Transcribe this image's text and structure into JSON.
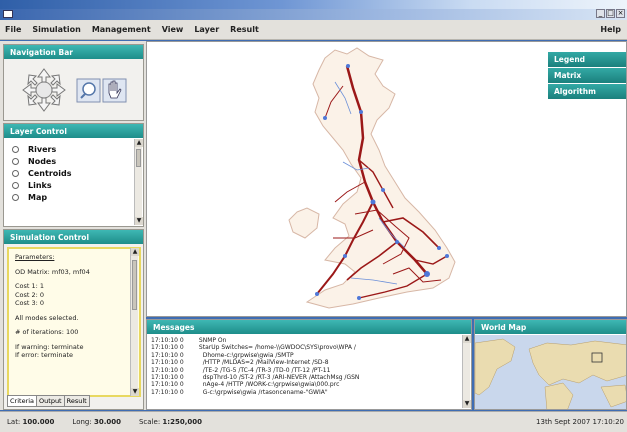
{
  "menu": {
    "items": [
      "File",
      "Simulation",
      "Management",
      "View",
      "Layer",
      "Result"
    ],
    "help": "Help"
  },
  "nav": {
    "title": "Navigation Bar"
  },
  "layer_control": {
    "title": "Layer Control",
    "layers": [
      "Rivers",
      "Nodes",
      "Centroids",
      "Links",
      "Map"
    ]
  },
  "simulation": {
    "title": "Simulation Control",
    "params_label": "Parameters:",
    "od_matrix": "OD Matrix: mf03, mf04",
    "cost1": "Cost 1:  1",
    "cost2": "Cost 2:  0",
    "cost3": "Cost 3:  0",
    "modes": "All modes selected.",
    "iterations": "# of iterations: 100",
    "if_warning": "If warning:  terminate",
    "if_error": "If error:  terminate",
    "tabs": [
      "Criteria",
      "Output",
      "Result"
    ]
  },
  "legend_panel": {
    "items": [
      "Legend",
      "Matrix",
      "Algorithm"
    ]
  },
  "messages": {
    "title": "Messages",
    "log": "17:10:10 0        SNMP On\n17:10:10 0        StarUp Switches= /home-\\\\GWDOC\\SYS\\provo\\WPA /\n17:10:10 0          Dhome-c:\\grpwise\\gwia /SMTP\n17:10:10 0          /HTTP /MLDAS=2 /MailView-Internet /SD-8\n17:10:10 0          /TE-2 /TG-5 /TC-4 /TR-3 /TD-0 /TT-12 /PT-11\n17:10:10 0          dspThrd-10 /ST-2 /RT-3 /ARI-NEVER /AttachMsg /GSN\n17:10:10 0          nAge-4 /HTTP /WORK-c:\\grpwise\\gwia\\000.prc\n17:10:10 0          G-c:\\grpwise\\gwia /rtasoncename-\"GWIA\""
  },
  "world_map": {
    "title": "World Map"
  },
  "status": {
    "lat_label": "Lat:",
    "lat": "100.000",
    "long_label": "Long:",
    "long": "30.000",
    "scale_label": "Scale:",
    "scale": "1:250,000",
    "datetime": "13th Sept 2007  17:10:20"
  },
  "colors": {
    "panel_header": "#2aa3a0",
    "route": "#9b1818",
    "river": "#6b8fd8"
  }
}
